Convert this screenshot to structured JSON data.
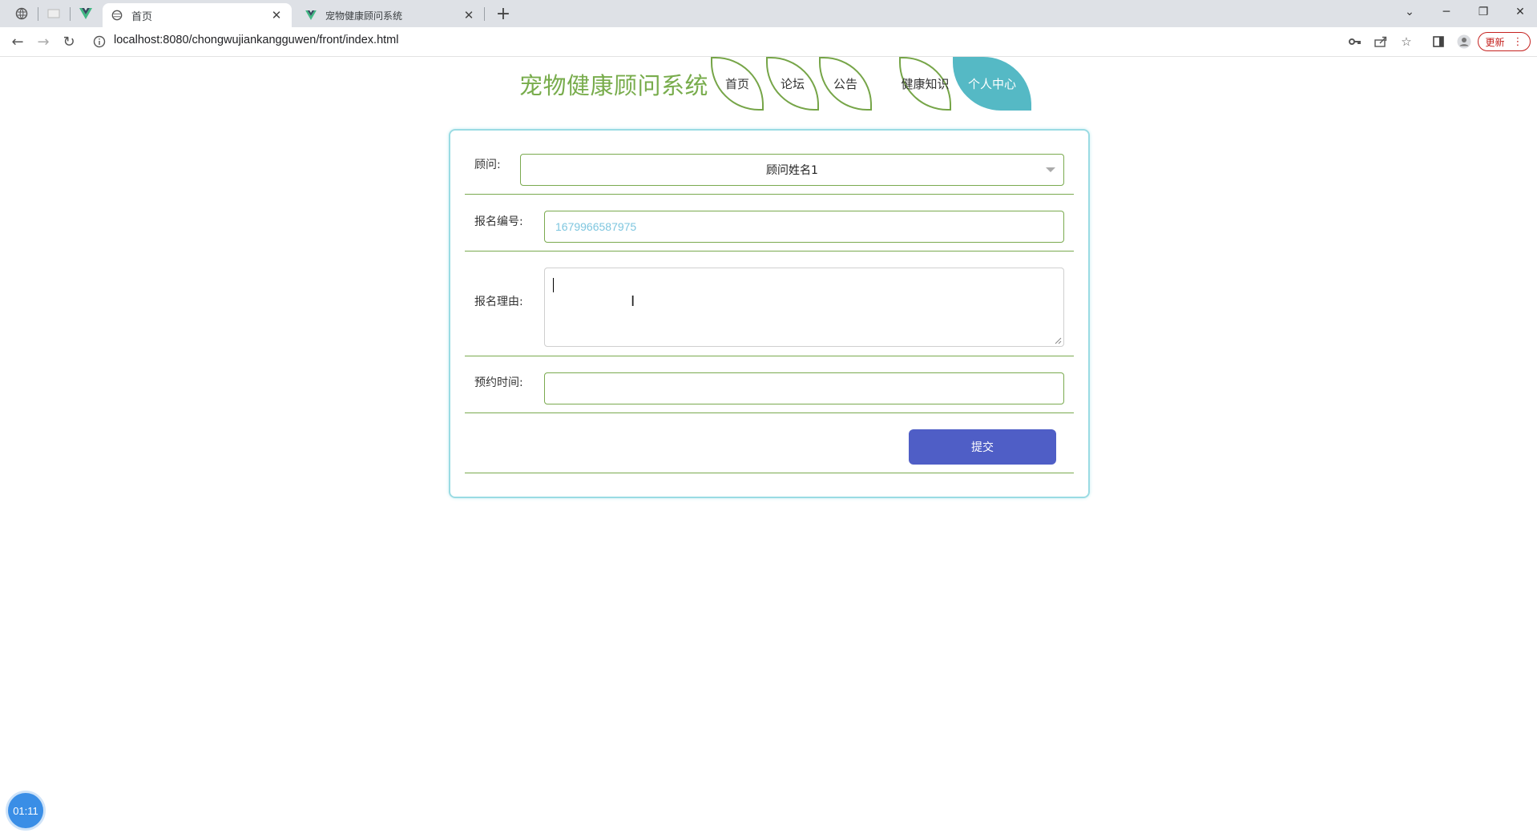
{
  "browser": {
    "tabs": [
      {
        "title": "首页",
        "active": true
      },
      {
        "title": "宠物健康顾问系统",
        "active": false
      }
    ],
    "url": "localhost:8080/chongwujiankangguwen/front/index.html",
    "update_label": "更新"
  },
  "site": {
    "title": "宠物健康顾问系统",
    "nav": [
      "首页",
      "论坛",
      "公告",
      "健康知识",
      "个人中心"
    ],
    "active_nav": "个人中心"
  },
  "form": {
    "advisor_label": "顾问:",
    "advisor_value": "顾问姓名1",
    "reg_no_label": "报名编号:",
    "reg_no_value": "1679966587975",
    "reason_label": "报名理由:",
    "reason_value": "",
    "time_label": "预约时间:",
    "time_value": "",
    "submit_label": "提交"
  },
  "timer": {
    "value": "01:11"
  },
  "colors": {
    "title_green": "#78ac4c",
    "nav_border": "#76a548",
    "nav_active": "#55b9c5",
    "card_border": "#9adbe3",
    "submit_blue": "#4f5ec6"
  }
}
